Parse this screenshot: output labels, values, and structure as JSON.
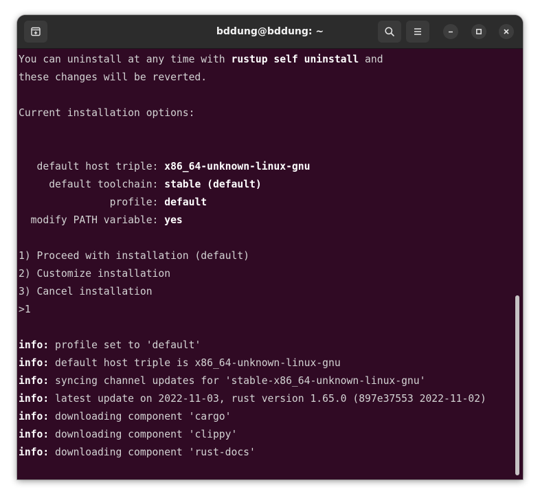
{
  "window": {
    "title": "bddung@bddung: ~",
    "icons": {
      "new_tab": "new-tab-icon",
      "search": "search-icon",
      "menu": "hamburger-menu-icon",
      "minimize": "minimize-icon",
      "maximize": "maximize-icon",
      "close": "close-icon"
    }
  },
  "terminal": {
    "l1a": "You can uninstall at any time with ",
    "l1b": "rustup self uninstall",
    "l1c": " and",
    "l2": "these changes will be reverted.",
    "l3": "Current installation options:",
    "opt_host_label": "   default host triple: ",
    "opt_host_value": "x86_64-unknown-linux-gnu",
    "opt_toolchain_label": "     default toolchain: ",
    "opt_toolchain_value": "stable (default)",
    "opt_profile_label": "               profile: ",
    "opt_profile_value": "default",
    "opt_path_label": "  modify PATH variable: ",
    "opt_path_value": "yes",
    "choice1": "1) Proceed with installation (default)",
    "choice2": "2) Customize installation",
    "choice3": "3) Cancel installation",
    "prompt": ">1",
    "info_prefix": "info:",
    "info1": " profile set to 'default'",
    "info2": " default host triple is x86_64-unknown-linux-gnu",
    "info3": " syncing channel updates for 'stable-x86_64-unknown-linux-gnu'",
    "info4": " latest update on 2022-11-03, rust version 1.65.0 (897e37553 2022-11-02)",
    "info5": " downloading component 'cargo'",
    "info6": " downloading component 'clippy'",
    "info7": " downloading component 'rust-docs'"
  }
}
